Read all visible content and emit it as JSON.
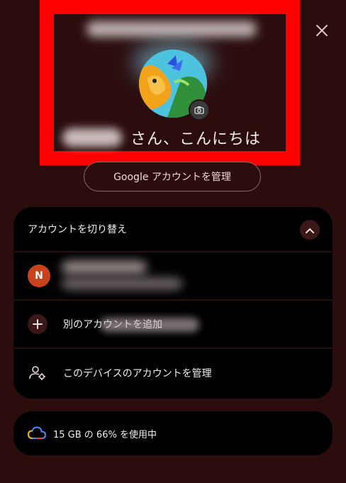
{
  "greeting": {
    "suffix": "さん、こんにちは"
  },
  "manage_account_button": "Google アカウントを管理",
  "switch_accounts": {
    "header": "アカウントを切り替え",
    "account_initial": "N",
    "add_account_label": "別のアカウントを追加",
    "manage_device_accounts_label": "このデバイスのアカウントを管理"
  },
  "storage": {
    "text": "15 GB の 66% を使用中",
    "percent_used": 66
  },
  "colors": {
    "background": "#2b0d0e",
    "card": "#000000",
    "highlight_border": "#ff0000",
    "account_avatar": "#c9421c"
  },
  "icons": [
    "close-icon",
    "camera-icon",
    "chevron-up-icon",
    "plus-icon",
    "manage-accounts-icon",
    "cloud-icon"
  ]
}
